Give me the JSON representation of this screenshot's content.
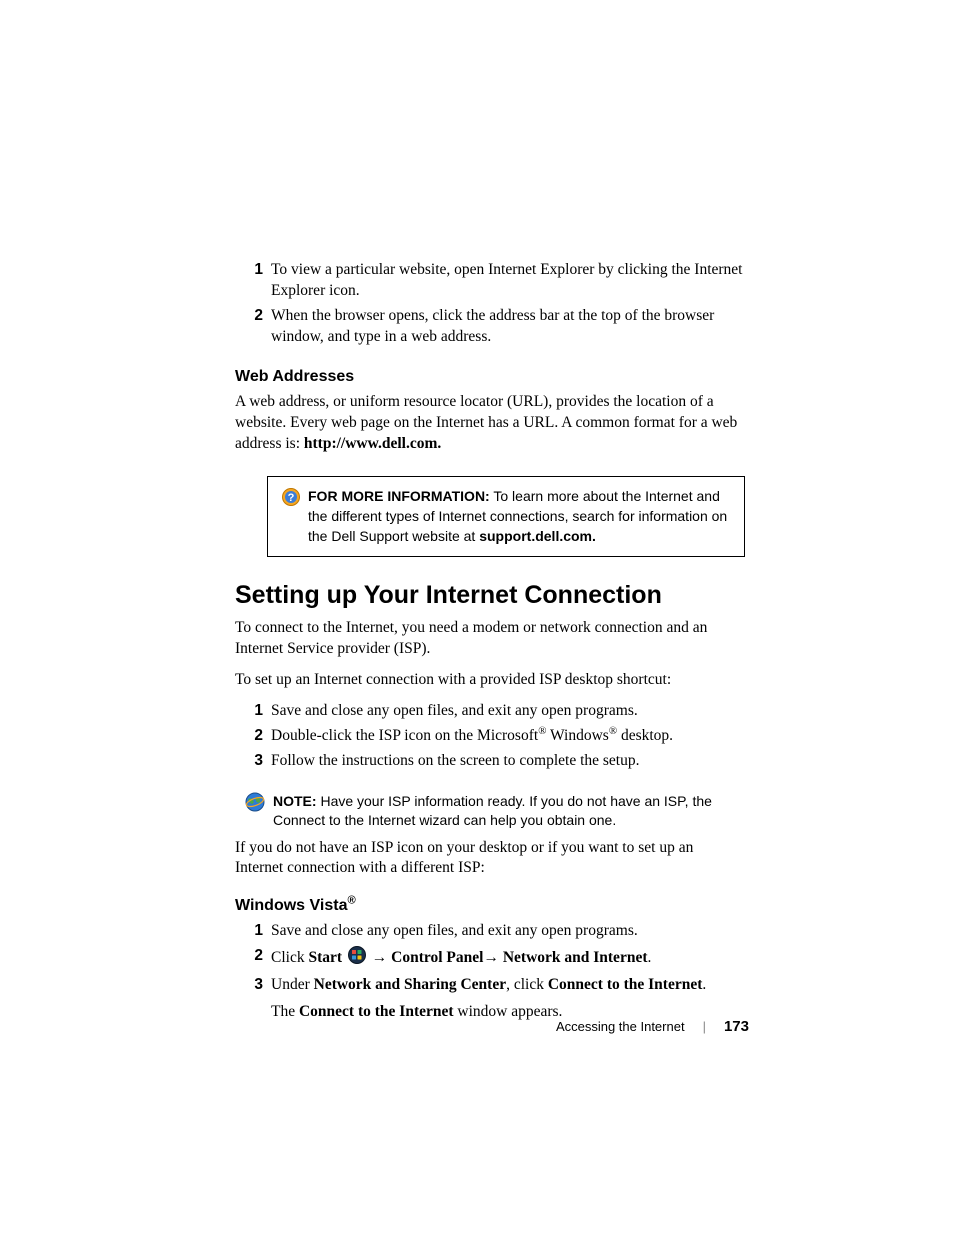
{
  "intro_list": [
    "To view a particular website, open Internet Explorer by clicking the Internet Explorer icon.",
    "When the browser opens, click the address bar at the top of the browser window, and type in a web address."
  ],
  "web_addresses": {
    "heading": "Web Addresses",
    "para_before": "A web address, or uniform resource locator (URL), provides the location of a website. Every web page on the Internet has a URL. A common format for a web address is: ",
    "url_bold": "http://www.dell.com."
  },
  "info_box": {
    "label": "FOR MORE INFORMATION:",
    "text": " To learn more about the Internet and the different types of Internet connections, search for information on the Dell Support website at ",
    "bold_end": "support.dell.com."
  },
  "main_heading": "Setting up Your Internet Connection",
  "intro_para1": "To connect to the Internet, you need a modem or network connection and an Internet Service provider (ISP).",
  "intro_para2": "To set up an Internet connection with a provided ISP desktop shortcut:",
  "steps1": {
    "s1": "Save and close any open files, and exit any open programs.",
    "s2_a": "Double-click the ISP icon on the Microsoft",
    "s2_b": " Windows",
    "s2_c": " desktop.",
    "s3": "Follow the instructions on the screen to complete the setup."
  },
  "note": {
    "label": "NOTE:",
    "text": " Have your ISP information ready. If you do not have an ISP, the Connect to the Internet wizard can help you obtain one."
  },
  "para_after_note": "If you do not have an ISP icon on your desktop or if you want to set up an Internet connection with a different ISP:",
  "vista": {
    "heading": "Windows Vista",
    "s1": "Save and close any open files, and exit any open programs.",
    "s2_click": "Click ",
    "s2_start": "Start",
    "s2_arrow1": " → ",
    "s2_cp": "Control Panel",
    "s2_arrow2": "→ ",
    "s2_ni": "Network and Internet",
    "s3_a": "Under ",
    "s3_b": "Network and Sharing Center",
    "s3_c": ", click ",
    "s3_d": "Connect to the Internet",
    "s3_line2a": "The ",
    "s3_line2b": "Connect to the Internet",
    "s3_line2c": " window appears."
  },
  "footer": {
    "chapter": "Accessing the Internet",
    "page": "173"
  }
}
